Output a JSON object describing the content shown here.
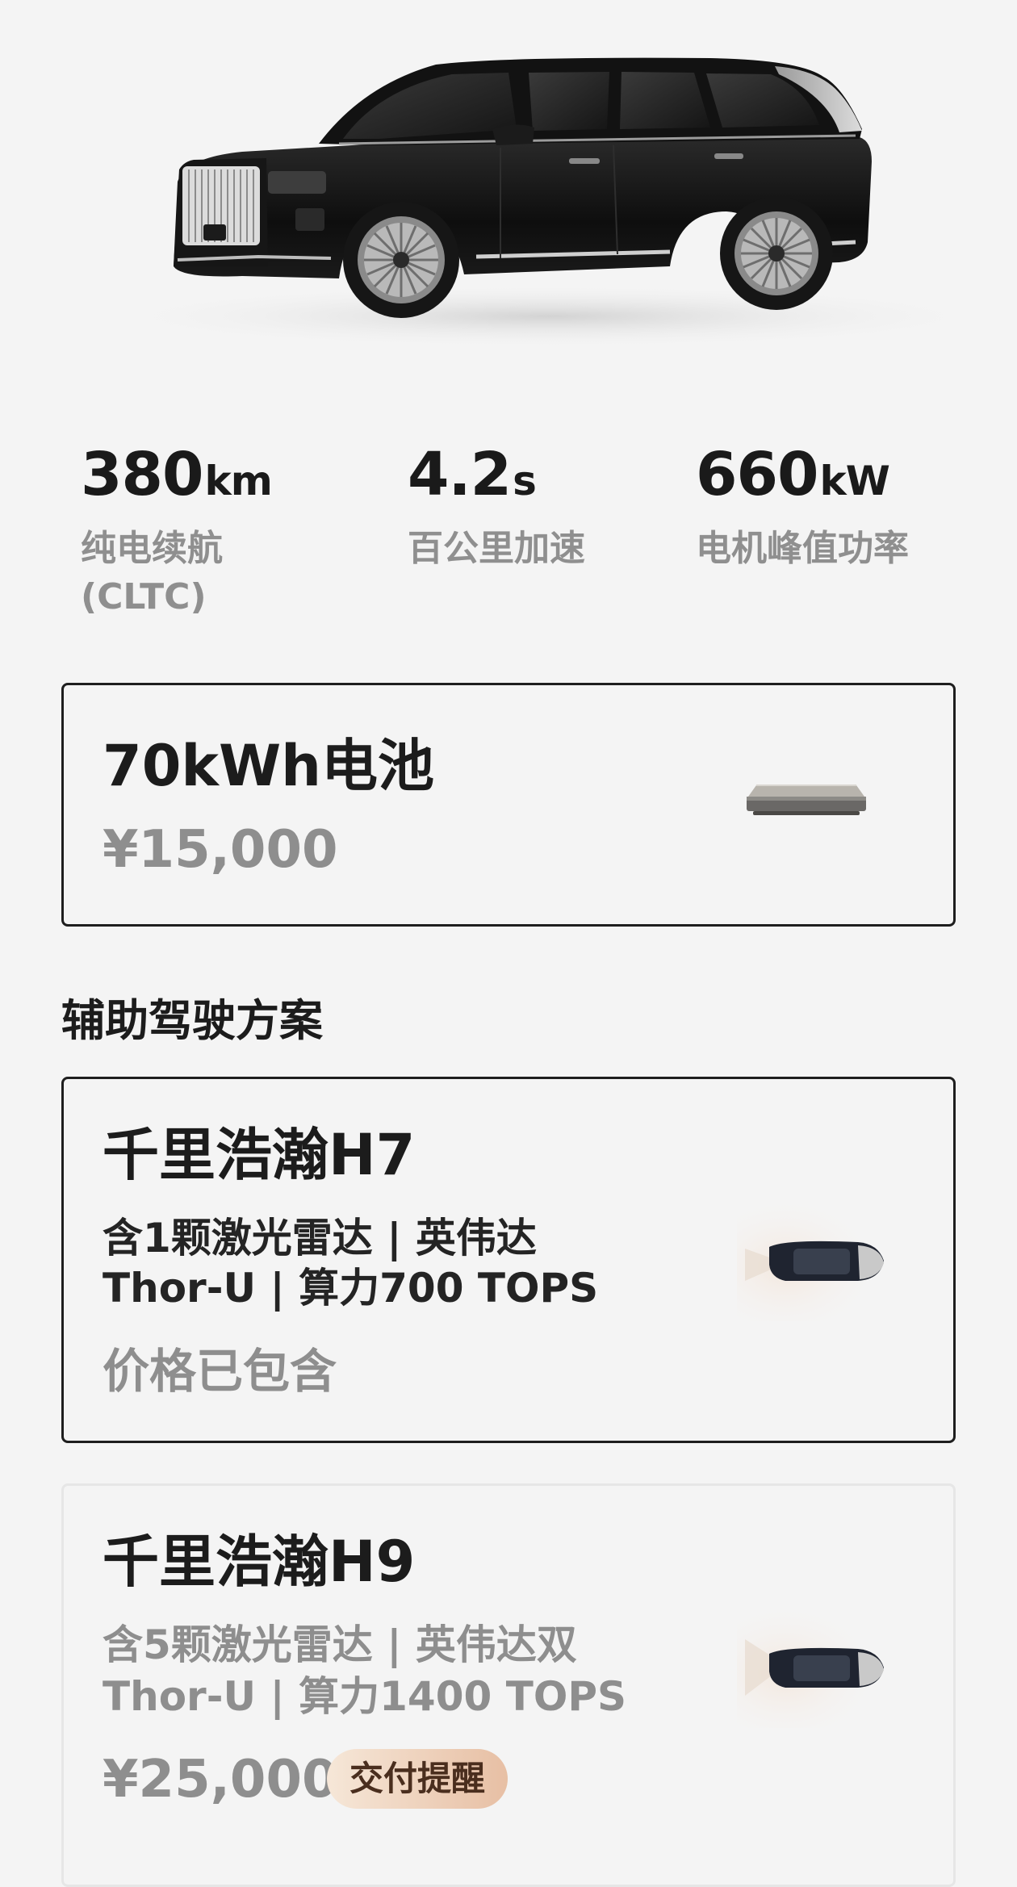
{
  "specs": [
    {
      "value": "380",
      "unit": "km",
      "label_line1": "纯电续航",
      "label_line2": "(CLTC)"
    },
    {
      "value": "4.2",
      "unit": "s",
      "label_line1": "百公里加速",
      "label_line2": ""
    },
    {
      "value": "660",
      "unit": "kW",
      "label_line1": "电机峰值功率",
      "label_line2": ""
    }
  ],
  "battery_option": {
    "title": "70kWh电池",
    "price": "¥15,000",
    "selected": true
  },
  "adas_section": {
    "title": "辅助驾驶方案",
    "options": [
      {
        "title": "千里浩瀚H7",
        "desc_line1": "含1颗激光雷达 | 英伟达",
        "desc_line2": "Thor-U | 算力700 TOPS",
        "price": "价格已包含",
        "selected": true
      },
      {
        "title": "千里浩瀚H9",
        "desc_line1": "含5颗激光雷达 | 英伟达双",
        "desc_line2": "Thor-U | 算力1400 TOPS",
        "price": "¥25,000",
        "badge": "交付提醒",
        "selected": false
      }
    ]
  },
  "colors": {
    "background": "#f4f4f4",
    "text_primary": "#1c1c1c",
    "text_secondary": "#8e8e8e",
    "selected_border": "#1e1e1e",
    "badge_gradient_start": "#f6e7d8",
    "badge_gradient_end": "#e7bfa4"
  }
}
